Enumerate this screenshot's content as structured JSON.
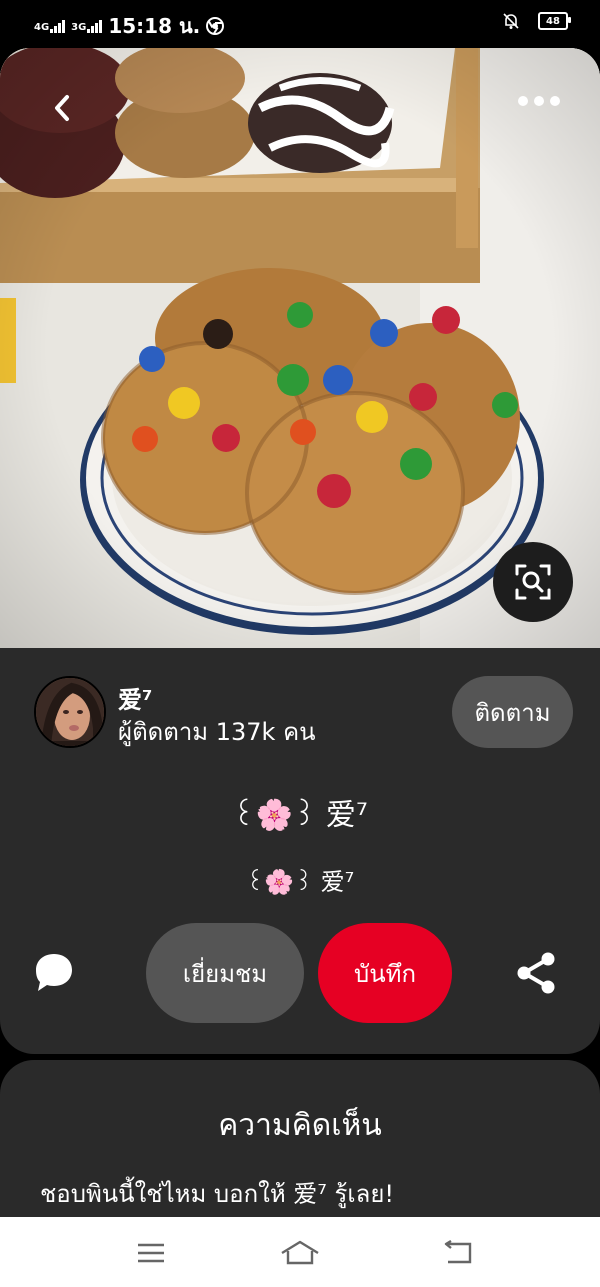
{
  "status_bar": {
    "network_1": "4G",
    "network_2": "3G",
    "time": "15:18 น.",
    "battery": "48",
    "icons": [
      "signal-icon",
      "chrome-icon",
      "notifications-off-icon",
      "battery-icon"
    ]
  },
  "pin": {
    "image_description_icon": "cookie-photo",
    "actions": {
      "back": "back-icon",
      "more": "more-icon",
      "visual_search": "visual-search-icon"
    }
  },
  "creator": {
    "name": "爱⁷",
    "followers": "ผู้ติดตาม 137k คน",
    "follow_label": "ติดตาม"
  },
  "title": "꒰🌸꒱ 爱⁷",
  "description": "꒰🌸꒱ 爱⁷",
  "buttons": {
    "visit": "เยี่ยมชม",
    "save": "บันทึก",
    "save_color": "#e60023"
  },
  "comments": {
    "title": "ความคิดเห็น",
    "prompt": "ชอบพินนี้ใช่ไหม บอกให้ 爱⁷ รู้เลย!"
  },
  "nav": {
    "icons": [
      "menu-icon",
      "home-icon",
      "back-nav-icon"
    ]
  }
}
